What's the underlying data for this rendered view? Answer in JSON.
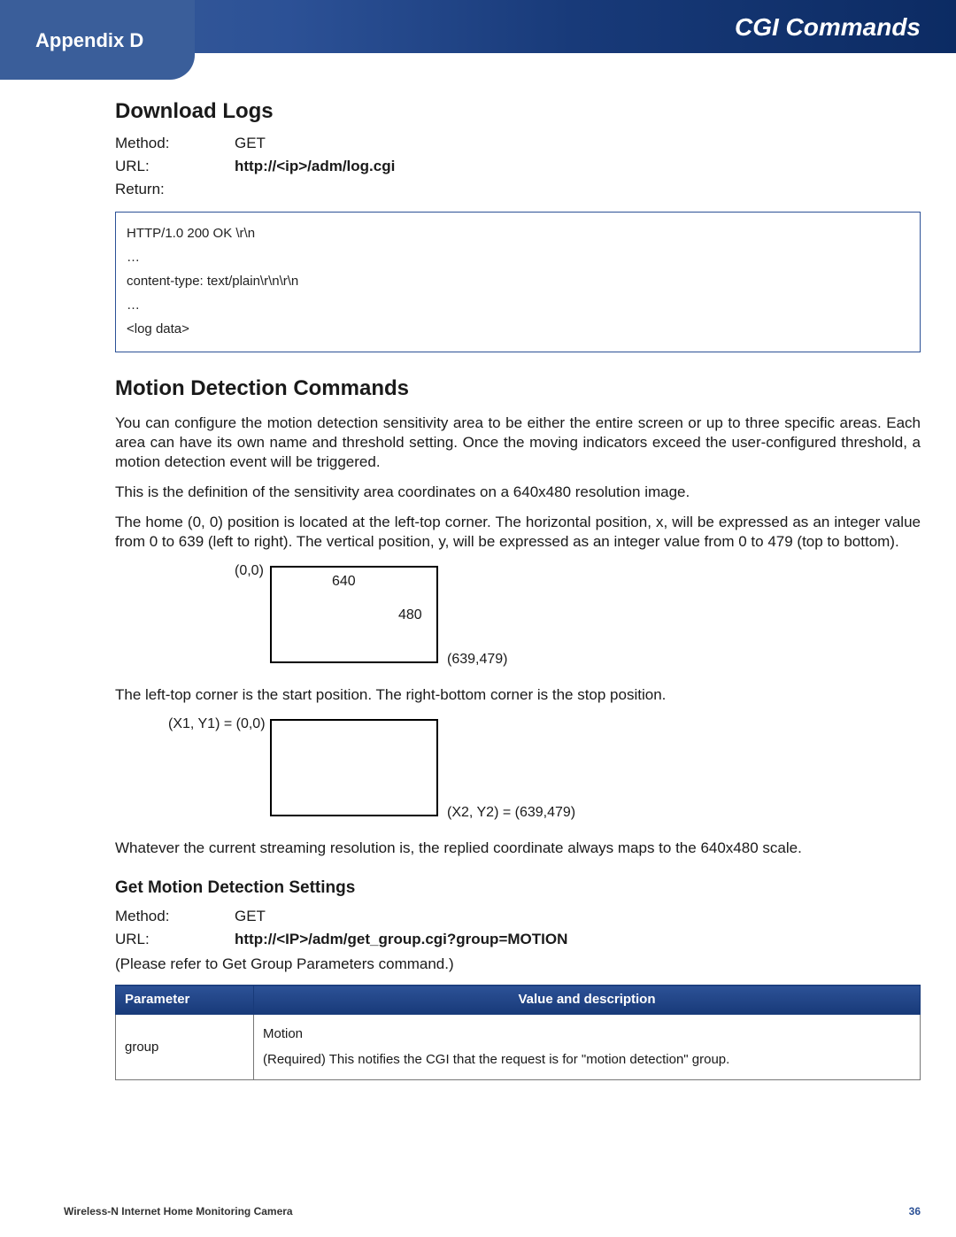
{
  "header": {
    "appendix_label": "Appendix D",
    "title_right": "CGI Commands"
  },
  "section_download_logs": {
    "heading": "Download Logs",
    "method_label": "Method:",
    "method_value": "GET",
    "url_label": "URL:",
    "url_value": "http://<ip>/adm/log.cgi",
    "return_label": "Return:",
    "code_lines": [
      "HTTP/1.0 200 OK \\r\\n",
      "…",
      "content-type: text/plain\\r\\n\\r\\n",
      "…",
      "<log data>"
    ]
  },
  "section_motion": {
    "heading": "Motion Detection Commands",
    "p1": "You can configure the motion detection sensitivity area to be either the entire screen or up to three specific areas. Each area can have its own name and threshold setting. Once the moving indicators exceed the user-configured threshold, a motion detection event will be triggered.",
    "p2": "This is the definition of the sensitivity area coordinates on a 640x480 resolution image.",
    "p3": "The home (0, 0) position is located at the left-top corner. The horizontal position, x, will be expressed as an integer value from 0 to 639 (left to right). The vertical position, y, will be expressed as an integer value from 0 to 479 (top to bottom).",
    "diagram1": {
      "tl": "(0,0)",
      "w": "640",
      "h": "480",
      "br": "(639,479)"
    },
    "p4": "The left-top corner is the start position. The right-bottom corner is the stop position.",
    "diagram2": {
      "tl": "(X1, Y1) = (0,0)",
      "br": "(X2, Y2) = (639,479)"
    },
    "p5": "Whatever the current streaming resolution is, the replied coordinate always maps to the 640x480 scale."
  },
  "section_get_motion": {
    "heading": "Get Motion Detection Settings",
    "method_label": "Method:",
    "method_value": "GET",
    "url_label": "URL:",
    "url_value": "http://<IP>/adm/get_group.cgi?group=MOTION",
    "note": "(Please refer to Get Group Parameters command.)",
    "table": {
      "col1": "Parameter",
      "col2": "Value and description",
      "rows": [
        {
          "param": "group",
          "value_line1": "Motion",
          "value_line2": "(Required) This notifies the CGI that the request is for \"motion detection\" group."
        }
      ]
    }
  },
  "footer": {
    "product": "Wireless-N Internet Home Monitoring Camera",
    "page": "36"
  }
}
